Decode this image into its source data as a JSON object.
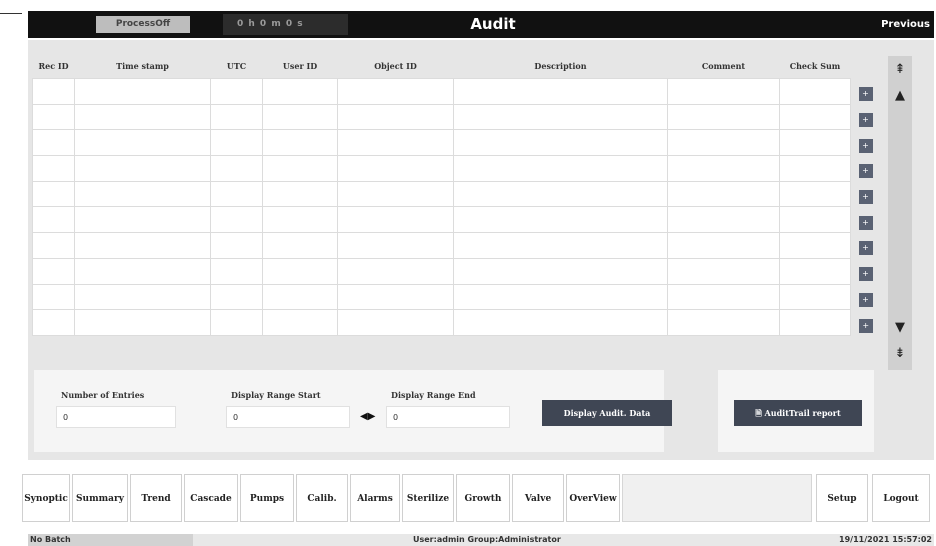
{
  "topbar": {
    "status_label": "ProcessOff",
    "code_label": "0 h 0 m 0 s",
    "title": "Audit",
    "previous_label": "Previous"
  },
  "table": {
    "headers": [
      "Rec ID",
      "Time stamp",
      "UTC",
      "User ID",
      "Object ID",
      "Description",
      "Comment",
      "Check Sum"
    ],
    "row_count": 10,
    "row_button_glyph": "+"
  },
  "scroll": {
    "first_icon": "double-up-arrow",
    "up_icon": "up-arrow",
    "down_icon": "down-arrow",
    "last_icon": "double-down-arrow"
  },
  "entries": {
    "number_label": "Number of Entries",
    "number_value": "0",
    "start_label": "Display Range Start",
    "start_value": "0",
    "end_label": "Display Range End",
    "end_value": "0",
    "display_button": "Display Audit. Data"
  },
  "report": {
    "button_label": "AuditTrail report"
  },
  "nav": {
    "items": [
      "Synoptic",
      "Summary",
      "Trend",
      "Cascade",
      "Pumps",
      "Calib.",
      "Alarms",
      "Sterilize",
      "Growth",
      "Valve",
      "OverView"
    ],
    "setup": "Setup",
    "logout": "Logout"
  },
  "status": {
    "batch": "No Batch",
    "user_info": "User:admin   Group:Administrator",
    "datetime": "19/11/2021 15:57:02"
  },
  "colors": {
    "topbar": "#111111",
    "panel": "#e6e6e6",
    "dark_button": "#3f4654"
  }
}
